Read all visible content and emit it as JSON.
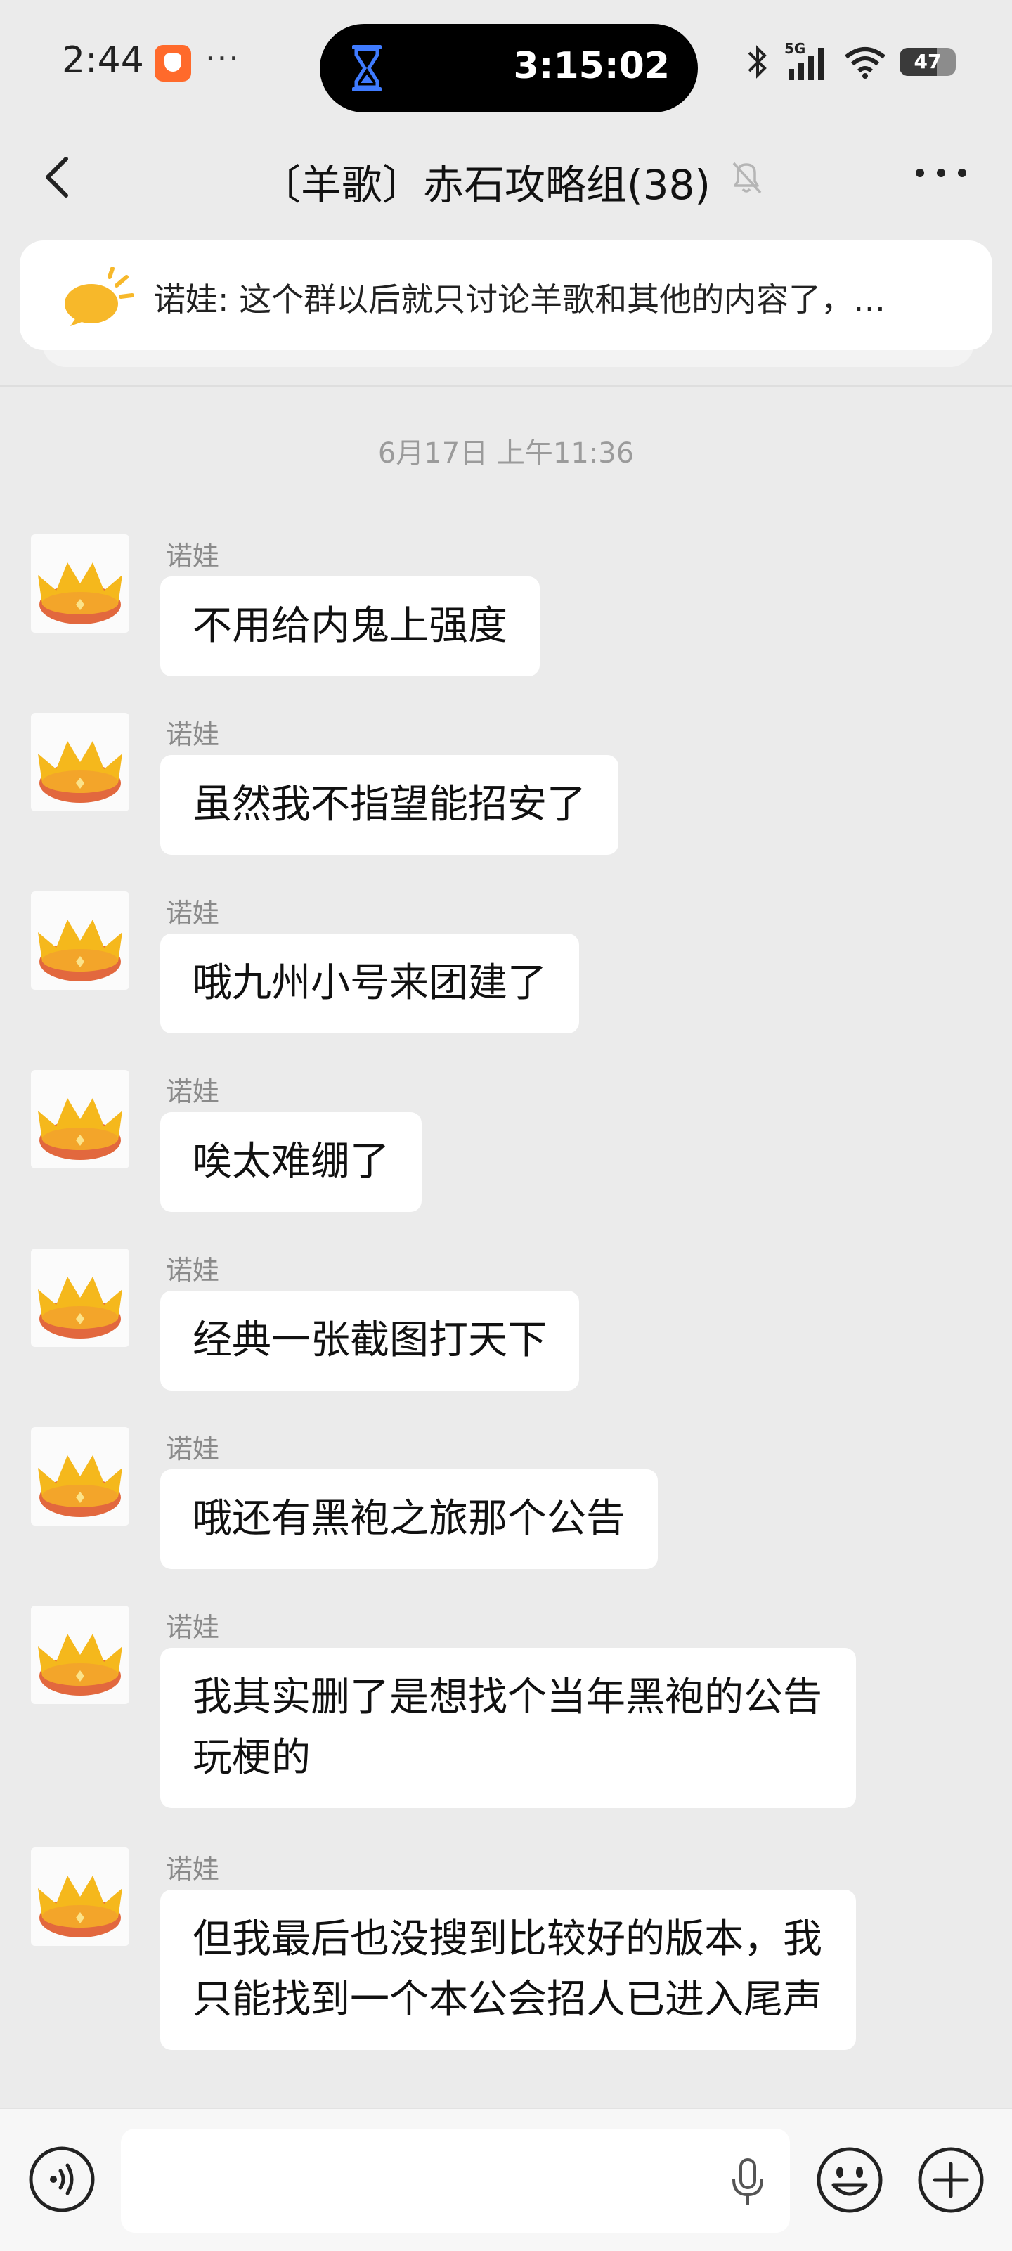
{
  "status_bar": {
    "time": "2:44",
    "more": "···",
    "timer": "3:15:02",
    "battery": "47"
  },
  "header": {
    "title": "〔羊歌〕赤石攻略组(38)"
  },
  "notice": {
    "text": "诺娃: 这个群以后就只讨论羊歌和其他的内容了，…"
  },
  "chat": {
    "timestamp": "6月17日 上午11:36",
    "messages": [
      {
        "sender": "诺娃",
        "text": "不用给内鬼上强度"
      },
      {
        "sender": "诺娃",
        "text": "虽然我不指望能招安了"
      },
      {
        "sender": "诺娃",
        "text": "哦九州小号来团建了"
      },
      {
        "sender": "诺娃",
        "text": "唉太难绷了"
      },
      {
        "sender": "诺娃",
        "text": "经典一张截图打天下"
      },
      {
        "sender": "诺娃",
        "text": "哦还有黑袍之旅那个公告"
      },
      {
        "sender": "诺娃",
        "text": "我其实删了是想找个当年黑袍的公告玩梗的"
      },
      {
        "sender": "诺娃",
        "text": "但我最后也没搜到比较好的版本，我只能找到一个本公会招人已进入尾声"
      }
    ]
  },
  "colors": {
    "background": "#ebebeb",
    "bubble": "#ffffff",
    "crown": "#f5b81c",
    "crown_band": "#e2683e"
  }
}
